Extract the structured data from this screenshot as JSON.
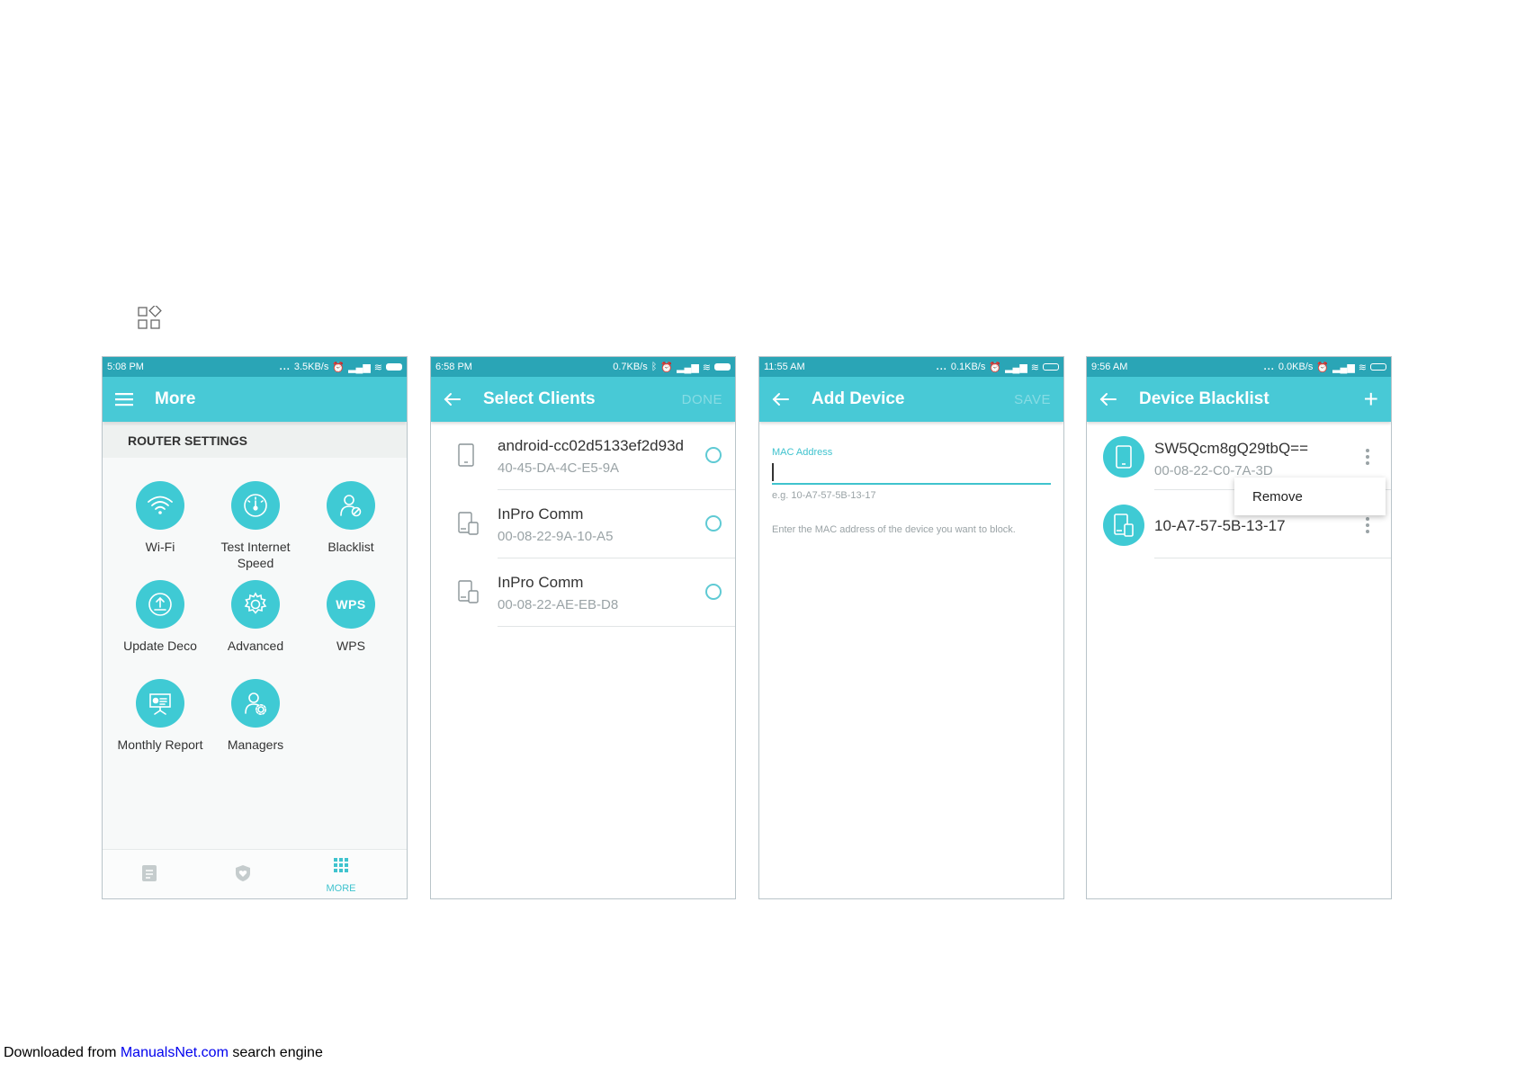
{
  "phone1": {
    "status": {
      "time": "5:08 PM",
      "speed": "3.5KB/s"
    },
    "title": "More",
    "section": "ROUTER SETTINGS",
    "tiles": [
      {
        "label": "Wi-Fi",
        "icon": "wifi-icon"
      },
      {
        "label": "Test Internet Speed",
        "icon": "speedometer-icon"
      },
      {
        "label": "Blacklist",
        "icon": "user-block-icon"
      },
      {
        "label": "Update Deco",
        "icon": "upload-icon"
      },
      {
        "label": "Advanced",
        "icon": "gear-icon"
      },
      {
        "label": "WPS",
        "icon": "wps-icon"
      },
      {
        "label": "Monthly Report",
        "icon": "report-board-icon"
      },
      {
        "label": "Managers",
        "icon": "user-gear-icon"
      }
    ],
    "wps_text": "WPS",
    "nav": {
      "more_label": "MORE"
    }
  },
  "phone2": {
    "status": {
      "time": "6:58 PM",
      "speed": "0.7KB/s"
    },
    "title": "Select Clients",
    "action": "DONE",
    "clients": [
      {
        "name": "android-cc02d5133ef2d93d",
        "mac": "40-45-DA-4C-E5-9A"
      },
      {
        "name": "InPro Comm",
        "mac": "00-08-22-9A-10-A5"
      },
      {
        "name": "InPro Comm",
        "mac": "00-08-22-AE-EB-D8"
      }
    ]
  },
  "phone3": {
    "status": {
      "time": "11:55 AM",
      "speed": "0.1KB/s"
    },
    "title": "Add Device",
    "action": "SAVE",
    "mac_label": "MAC Address",
    "mac_value": "",
    "mac_hint": "e.g. 10-A7-57-5B-13-17",
    "help": "Enter the MAC address of the device you want to block."
  },
  "phone4": {
    "status": {
      "time": "9:56 AM",
      "speed": "0.0KB/s"
    },
    "title": "Device Blacklist",
    "items": [
      {
        "name": "SW5Qcm8gQ29tbQ==",
        "mac": "00-08-22-C0-7A-3D"
      },
      {
        "name": "10-A7-57-5B-13-17",
        "mac": ""
      }
    ],
    "popup": "Remove"
  },
  "footer": {
    "prefix": "Downloaded from ",
    "link": "ManualsNet.com",
    "suffix": " search engine"
  },
  "colors": {
    "status_bar": "#2aa5b6",
    "app_bar": "#48c9d6",
    "accent": "#3fcad4"
  }
}
